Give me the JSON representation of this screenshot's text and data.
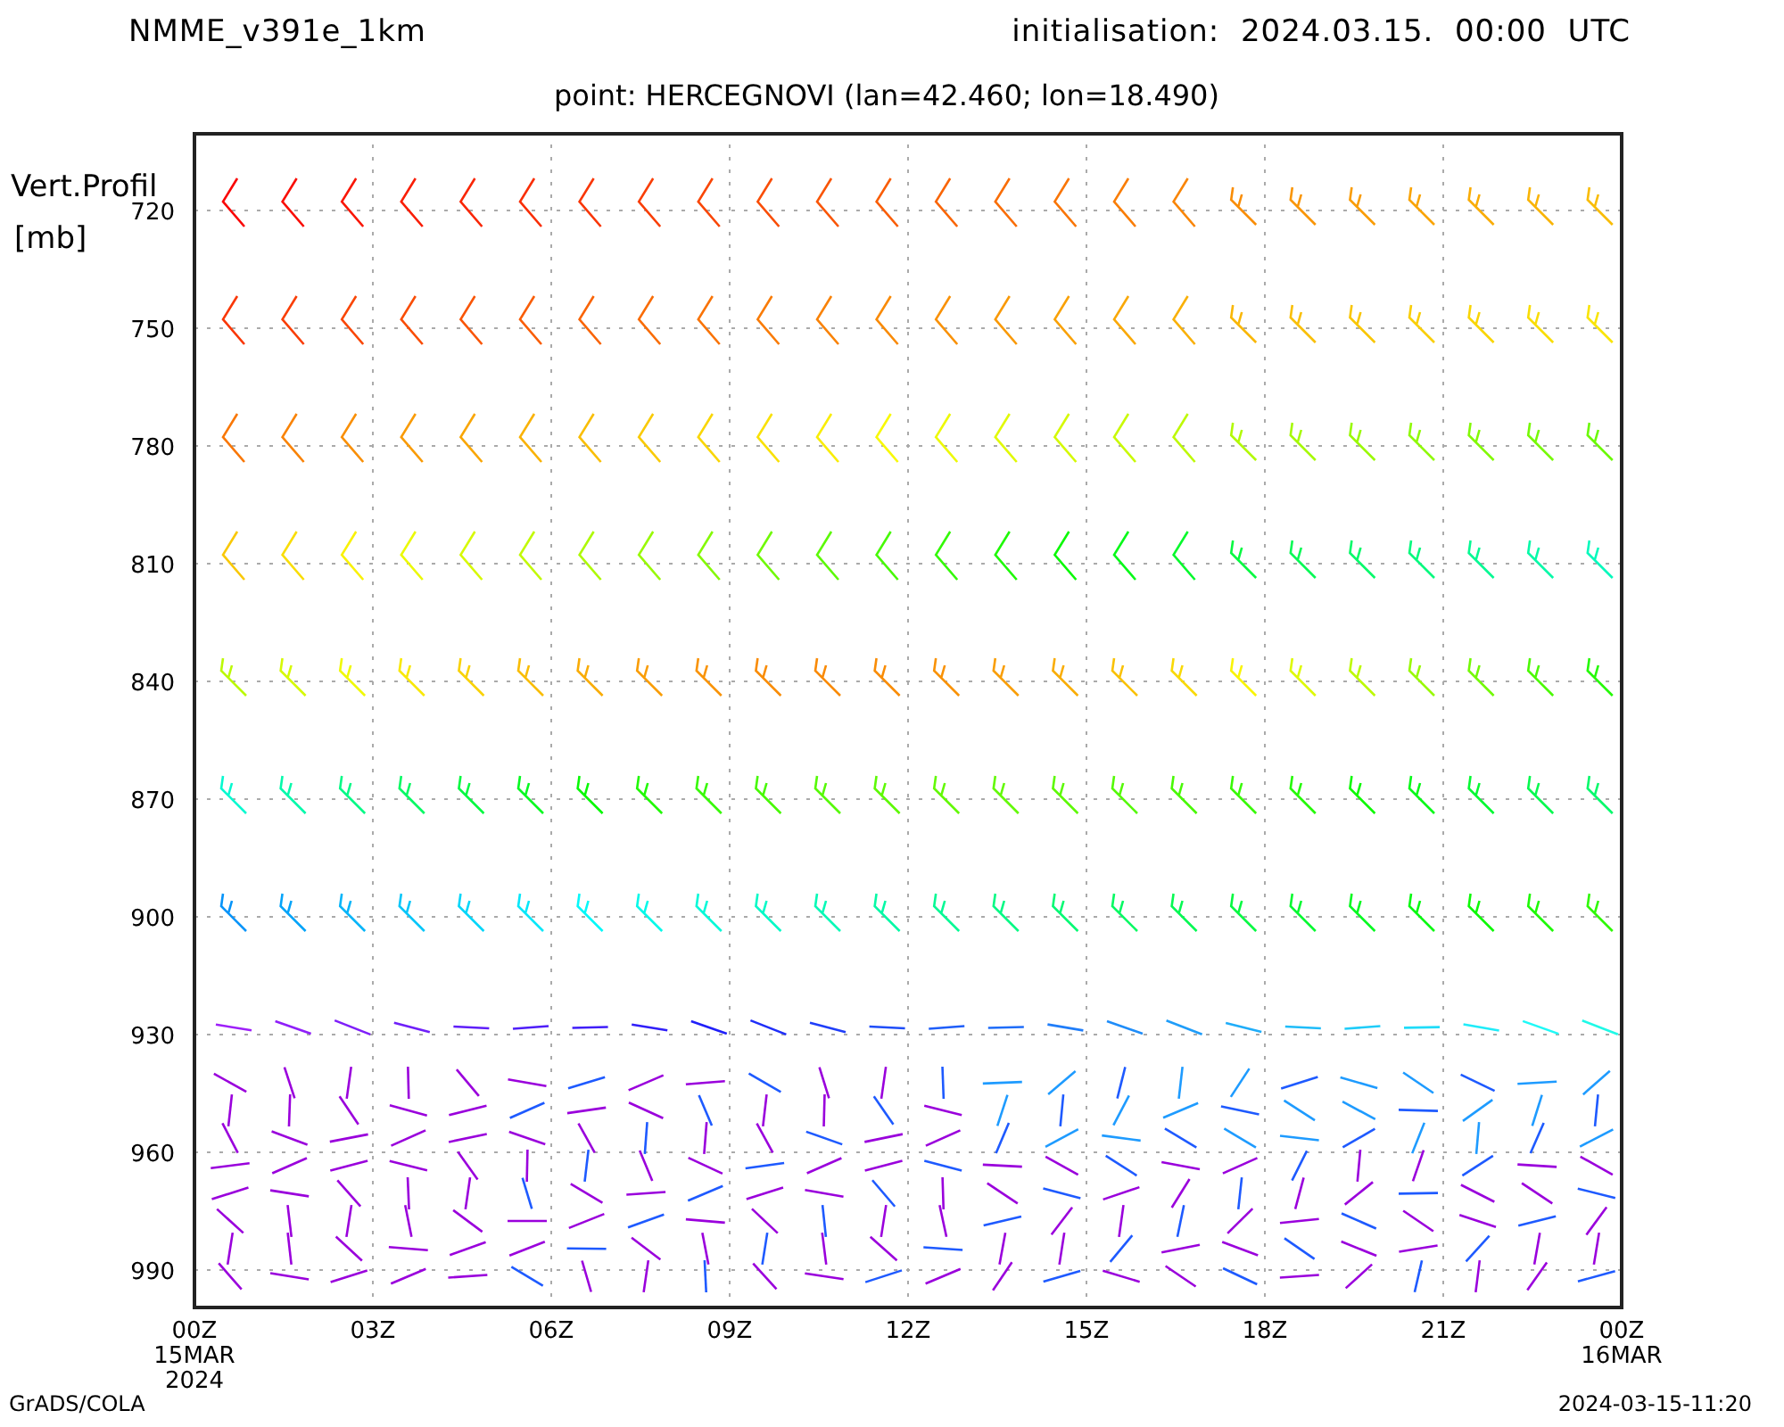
{
  "header": {
    "model": "NMME_v391e_1km",
    "initialisation": "initialisation:  2024.03.15.  00:00  UTC"
  },
  "point": "point: HERCEGNOVI (lan=42.460; lon=18.490)",
  "y_axis": {
    "label": "Vert.Profil",
    "unit": "[mb]",
    "ticks": [
      "720",
      "750",
      "780",
      "810",
      "840",
      "870",
      "900",
      "930",
      "960",
      "990"
    ]
  },
  "x_axis": {
    "ticks": [
      {
        "lines": [
          "00Z",
          "15MAR",
          "2024"
        ]
      },
      {
        "lines": [
          "03Z"
        ]
      },
      {
        "lines": [
          "06Z"
        ]
      },
      {
        "lines": [
          "09Z"
        ]
      },
      {
        "lines": [
          "12Z"
        ]
      },
      {
        "lines": [
          "15Z"
        ]
      },
      {
        "lines": [
          "18Z"
        ]
      },
      {
        "lines": [
          "21Z"
        ]
      },
      {
        "lines": [
          "00Z",
          "16MAR"
        ]
      }
    ]
  },
  "footer": {
    "left": "GrADS/COLA",
    "right": "2024-03-15-11:20"
  }
}
